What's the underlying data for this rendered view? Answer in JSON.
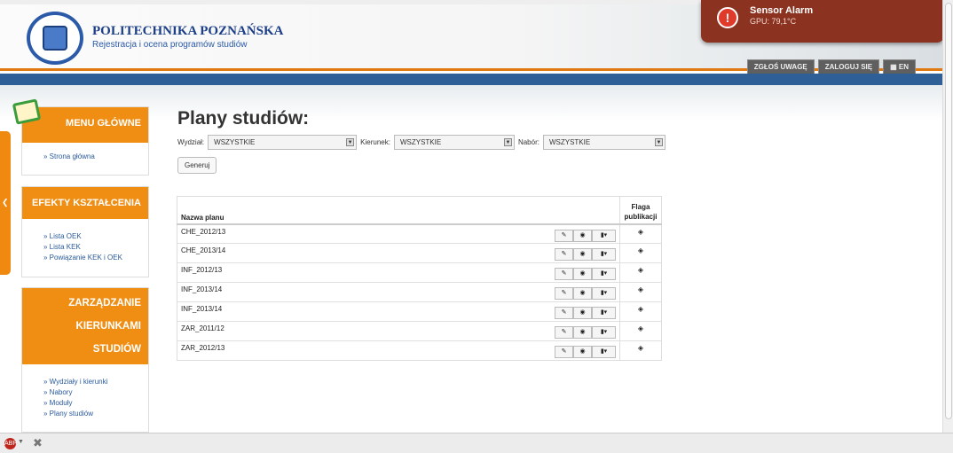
{
  "header": {
    "title": "POLITECHNIKA POZNAŃSKA",
    "subtitle": "Rejestracja i ocena programów studiów",
    "buttons": [
      "ZGŁOŚ UWAGĘ",
      "ZALOGUJ SIĘ",
      "EN"
    ]
  },
  "notification": {
    "title": "Sensor Alarm",
    "text": "GPU: 79,1°C"
  },
  "sidebar": {
    "menus": [
      {
        "title": "MENU GŁÓWNE",
        "items": [
          "» Strona główna"
        ]
      },
      {
        "title": "EFEKTY KSZTAŁCENIA",
        "items": [
          "» Lista OEK",
          "» Lista KEK",
          "» Powiązanie KEK i OEK"
        ]
      },
      {
        "title_lines": [
          "ZARZĄDZANIE",
          "KIERUNKAMI",
          "STUDIÓW"
        ],
        "items": [
          "» Wydziały i kierunki",
          "» Nabory",
          "» Moduły",
          "» Plany studiów"
        ]
      }
    ]
  },
  "main": {
    "title": "Plany studiów:",
    "filters": {
      "wydzial_label": "Wydział:",
      "wydzial_value": "WSZYSTKIE",
      "kierunek_label": "Kierunek:",
      "kierunek_value": "WSZYSTKIE",
      "nabor_label": "Nabór:",
      "nabor_value": "WSZYSTKIE"
    },
    "generate_label": "Generuj",
    "table": {
      "col_name": "Nazwa planu",
      "col_flag_line1": "Flaga",
      "col_flag_line2": "publikacji",
      "rows": [
        "CHE_2012/13",
        "CHE_2013/14",
        "INF_2012/13",
        "INF_2013/14",
        "INF_2013/14",
        "ZAR_2011/12",
        "ZAR_2012/13"
      ]
    }
  },
  "icons": {
    "edit": "✎",
    "view": "◉",
    "file": "▮▾",
    "flag": "◈"
  }
}
